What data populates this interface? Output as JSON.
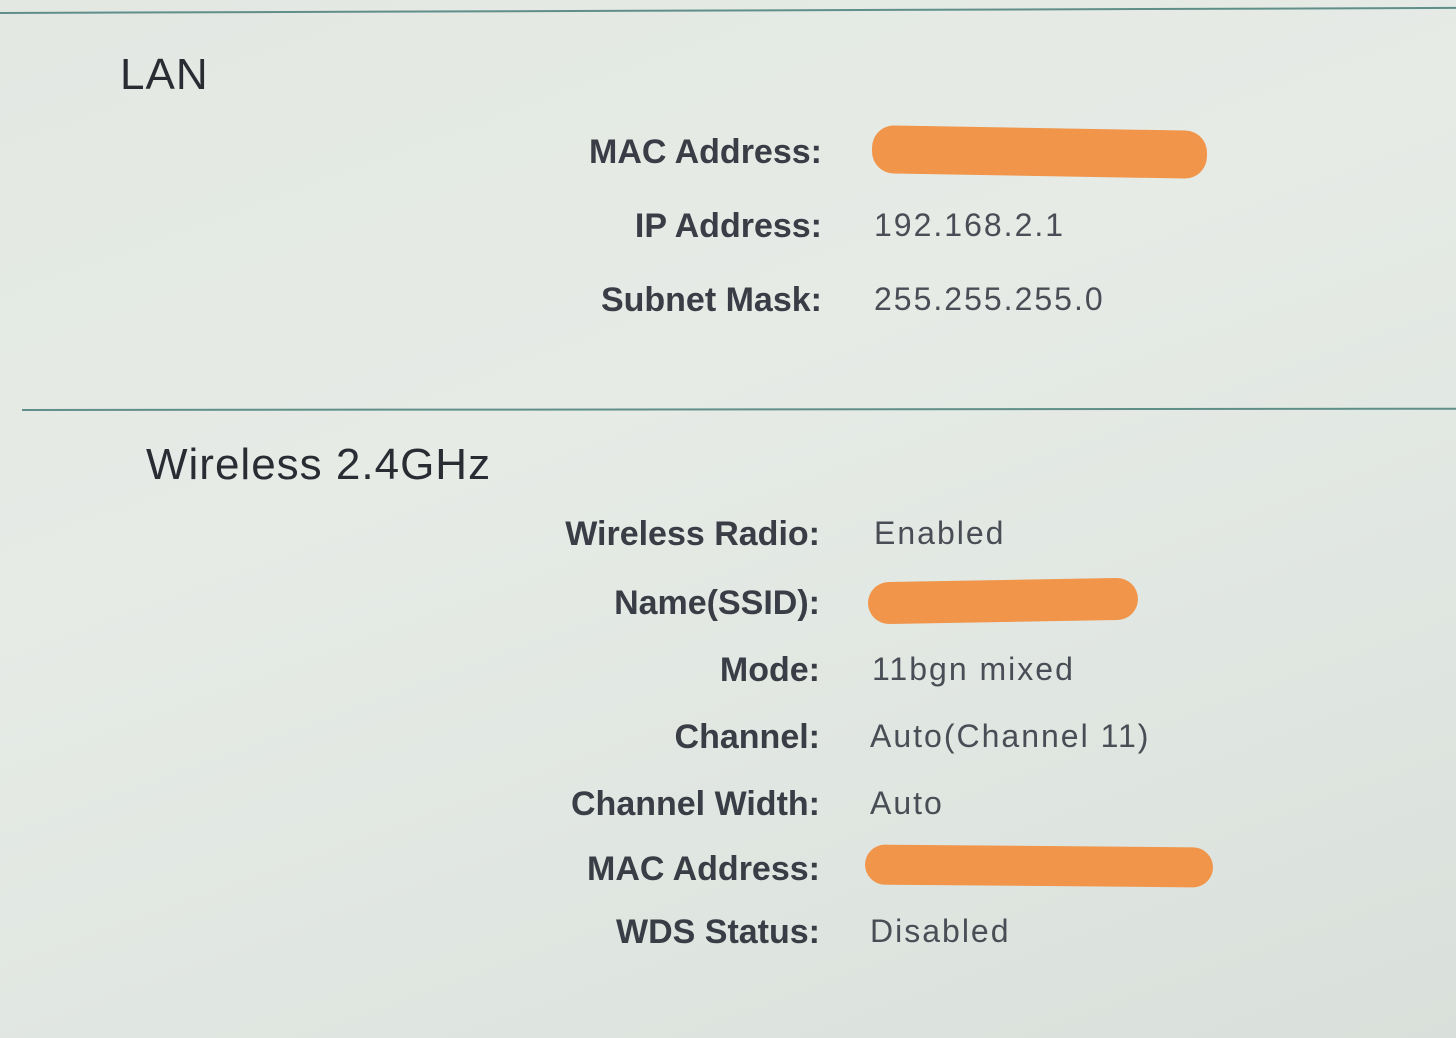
{
  "lan": {
    "title": "LAN",
    "mac_label": "MAC Address:",
    "ip_label": "IP Address:",
    "ip_value": "192.168.2.1",
    "subnet_label": "Subnet Mask:",
    "subnet_value": "255.255.255.0"
  },
  "wireless": {
    "title": "Wireless 2.4GHz",
    "radio_label": "Wireless Radio:",
    "radio_value": "Enabled",
    "ssid_label": "Name(SSID):",
    "mode_label": "Mode:",
    "mode_value": "11bgn mixed",
    "channel_label": "Channel:",
    "channel_value": "Auto(Channel 11)",
    "width_label": "Channel Width:",
    "width_value": "Auto",
    "mac_label": "MAC Address:",
    "wds_label": "WDS Status:",
    "wds_value": "Disabled"
  },
  "colors": {
    "redaction": "#f0954a",
    "divider": "#5f8f88"
  }
}
